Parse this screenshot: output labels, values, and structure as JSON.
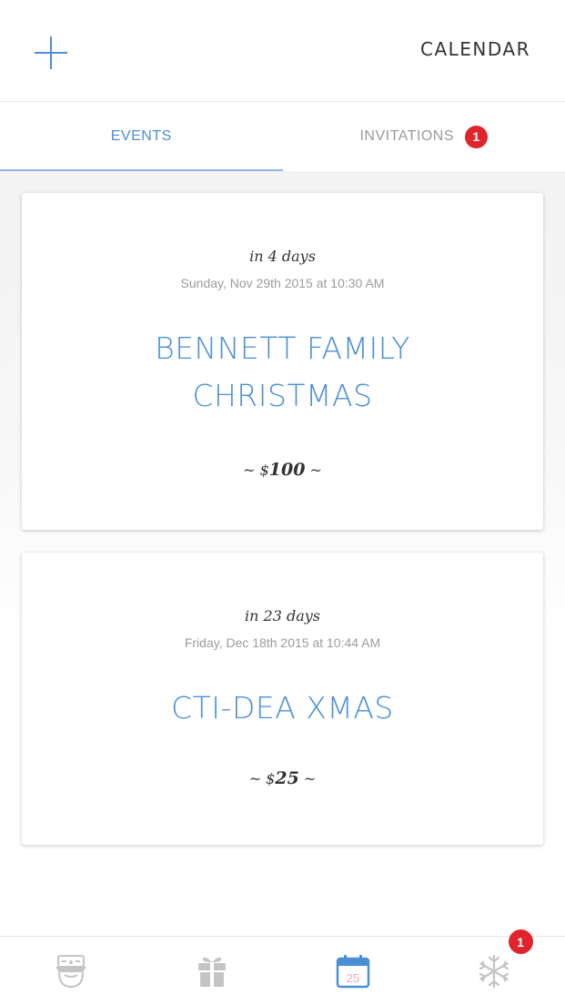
{
  "header": {
    "title": "CALENDAR",
    "add_icon": "plus-icon"
  },
  "tabs": [
    {
      "label": "EVENTS",
      "active": true
    },
    {
      "label": "INVITATIONS",
      "active": false,
      "badge": "1"
    }
  ],
  "events": [
    {
      "relative": "in 4 days",
      "date": "Sunday, Nov 29th 2015 at 10:30 AM",
      "title": "BENNETT FAMILY CHRISTMAS",
      "price_prefix": "~ $",
      "price_amount": "100",
      "price_suffix": " ~"
    },
    {
      "relative": "in 23 days",
      "date": "Friday, Dec 18th 2015 at 10:44 AM",
      "title": "CTI-DEA XMAS",
      "price_prefix": "~ $",
      "price_amount": "25",
      "price_suffix": " ~"
    }
  ],
  "bottom_nav": {
    "items": [
      {
        "icon": "santa-icon",
        "active": false
      },
      {
        "icon": "gift-icon",
        "active": false
      },
      {
        "icon": "calendar-icon",
        "active": true,
        "text": "25"
      },
      {
        "icon": "snowflake-icon",
        "active": false
      }
    ],
    "calendar_badge": "1"
  },
  "colors": {
    "accent": "#4a8fd6",
    "badge": "#e0242b",
    "inactive": "#9b9b9b",
    "calendar_date_text": "#f2a7b4"
  }
}
